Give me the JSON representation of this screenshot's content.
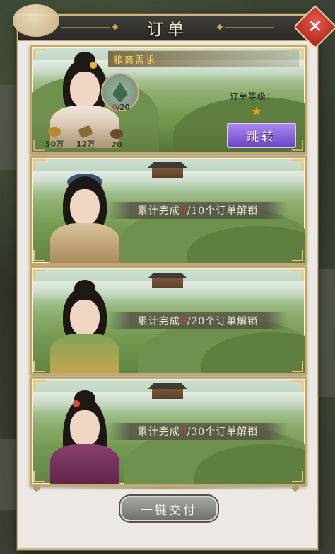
{
  "window": {
    "title": "订单"
  },
  "orders": [
    {
      "requester": "粮商需求",
      "progress_current": "0",
      "progress_total": "/20",
      "grade_label": "订单等级：",
      "grade_stars": 1,
      "rewards": [
        {
          "icon": "coin-icon",
          "amount": "50万"
        },
        {
          "icon": "grain-icon",
          "amount": "12万"
        },
        {
          "icon": "feather-icon",
          "amount": "20"
        }
      ],
      "jump_label": "跳转"
    },
    {
      "lock_prefix": "累计完成",
      "lock_count": "0",
      "lock_suffix": "/10个订单解锁"
    },
    {
      "lock_prefix": "累计完成",
      "lock_count": "0",
      "lock_suffix": "/20个订单解锁"
    },
    {
      "lock_prefix": "累计完成",
      "lock_count": "0",
      "lock_suffix": "/30个订单解锁"
    }
  ],
  "footer": {
    "deliver_all_label": "一键交付"
  },
  "colors": {
    "accent_gold": "#c7a766",
    "jump_purple": "#6b47c7",
    "progress_red": "#d62b20"
  }
}
